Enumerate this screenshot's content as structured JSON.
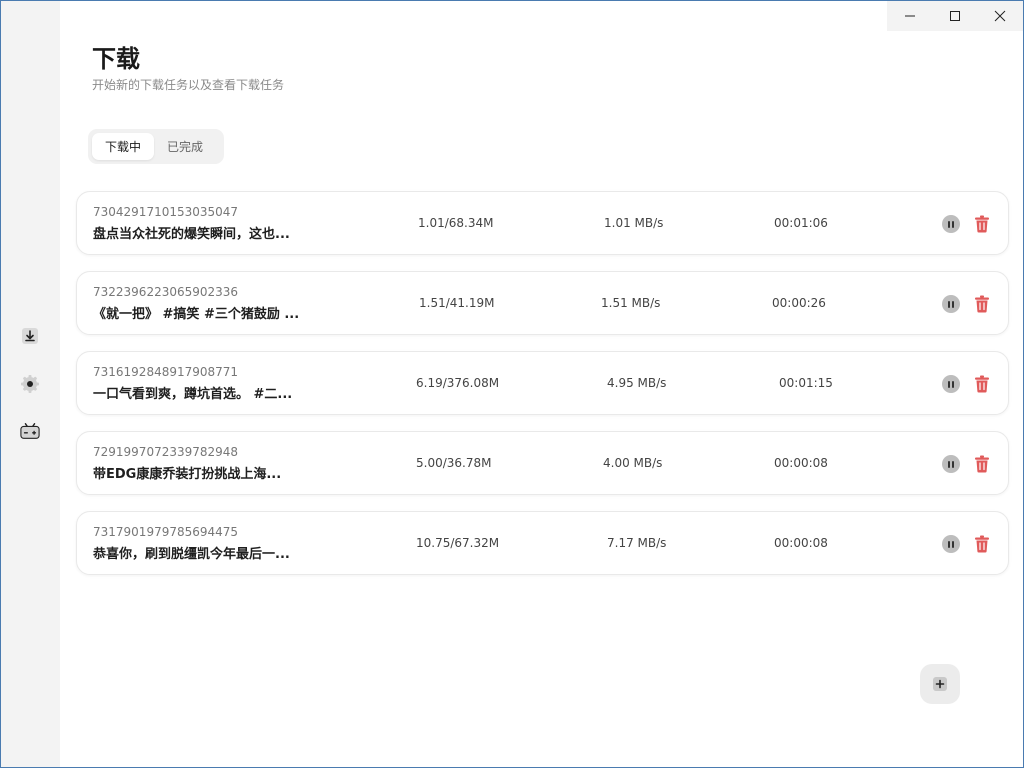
{
  "page": {
    "title": "下载",
    "subtitle": "开始新的下载任务以及查看下载任务"
  },
  "tabs": [
    {
      "label": "下载中",
      "active": true
    },
    {
      "label": "已完成",
      "active": false
    }
  ],
  "downloads": [
    {
      "id": "7304291710153035047",
      "title": "盘点当众社死的爆笑瞬间，这也...",
      "progress": "1.01/68.34M",
      "speed": "1.01 MB/s",
      "eta": "00:01:06"
    },
    {
      "id": "7322396223065902336",
      "title": "《就一把》 #搞笑 #三个猪鼓励 ...",
      "progress": "1.51/41.19M",
      "speed": "1.51 MB/s",
      "eta": "00:00:26"
    },
    {
      "id": "7316192848917908771",
      "title": "一口气看到爽，蹲坑首选。 #二...",
      "progress": "6.19/376.08M",
      "speed": "4.95 MB/s",
      "eta": "00:01:15"
    },
    {
      "id": "7291997072339782948",
      "title": "带EDG康康乔装打扮挑战上海...",
      "progress": "5.00/36.78M",
      "speed": "4.00 MB/s",
      "eta": "00:00:08"
    },
    {
      "id": "7317901979785694475",
      "title": "恭喜你，刷到脱缰凯今年最后一...",
      "progress": "10.75/67.32M",
      "speed": "7.17 MB/s",
      "eta": "00:00:08"
    }
  ],
  "sidebar": {
    "items": [
      {
        "icon": "download-icon"
      },
      {
        "icon": "settings-gear-icon"
      },
      {
        "icon": "bilibili-icon"
      }
    ]
  },
  "icons": {
    "pause": "pause-icon",
    "delete": "trash-icon",
    "add": "plus-icon"
  },
  "colors": {
    "delete": "#e05a5a",
    "pause_bg": "#bdbdbd",
    "sidebar_bg": "#f3f3f3"
  }
}
